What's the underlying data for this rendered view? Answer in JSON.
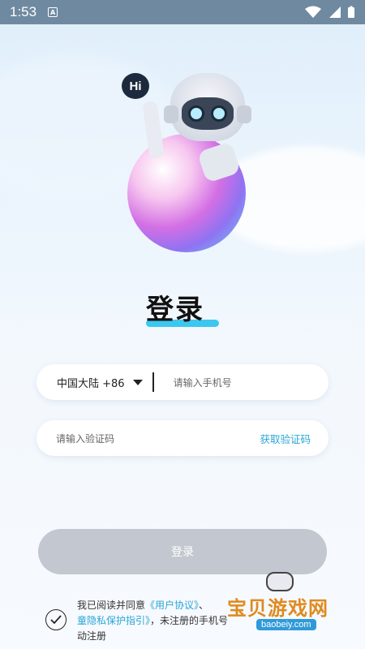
{
  "status_bar": {
    "time": "1:53",
    "notification_icon": "A",
    "icons": [
      "wifi-icon",
      "signal-icon",
      "battery-icon"
    ]
  },
  "hero": {
    "bubble_text": "Hi"
  },
  "page": {
    "title": "登录"
  },
  "phone_field": {
    "region": "中国大陆 +86",
    "placeholder": "请输入手机号"
  },
  "code_field": {
    "placeholder": "请输入验证码",
    "get_code": "获取验证码"
  },
  "login_button": {
    "label": "登录"
  },
  "agreement": {
    "prefix": "我已阅读并同意",
    "user_agreement": "《用户协议》",
    "sep": "、",
    "privacy_link": "童隐私保护指引》",
    "suffix": "，未注册的手机号",
    "line3": "动注册"
  },
  "watermark": {
    "text": "宝贝游戏网",
    "url": "baobeiy.com"
  },
  "colors": {
    "accent": "#2aa6d6",
    "underline": "#3cc7ef",
    "button_disabled": "#c3c8d0"
  }
}
